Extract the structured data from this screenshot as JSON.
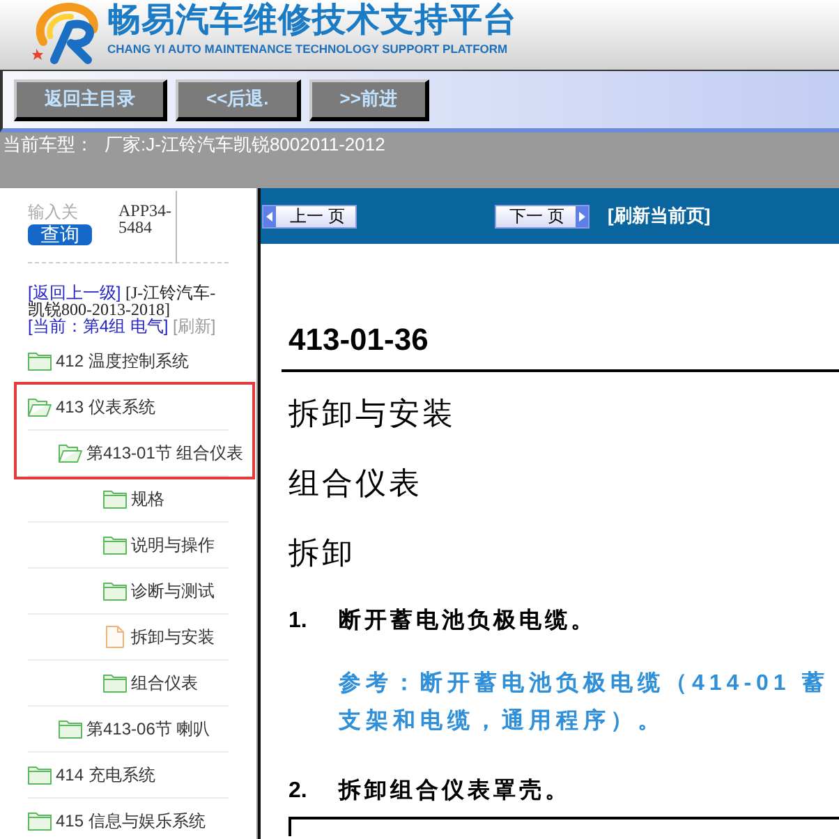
{
  "header": {
    "title": "畅易汽车维修技术支持平台",
    "subtitle": "CHANG YI AUTO MAINTENANCE TECHNOLOGY SUPPORT PLATFORM"
  },
  "nav_buttons": [
    "返回主目录",
    "<<后退.",
    ">>前进"
  ],
  "current_model": {
    "label": "当前车型：",
    "value": "厂家:J-江铃汽车凯锐8002011-2012"
  },
  "sidebar": {
    "search": {
      "placeholder": "输入关",
      "button": "查询"
    },
    "app_code": "APP34-5484",
    "breadcrumb": [
      {
        "kind": "link",
        "text": "[返回上一级]"
      },
      {
        "kind": "plain",
        "text": "[J-江铃汽车-凯锐800-2013-2018]"
      },
      {
        "kind": "link",
        "text": "[当前：第4组 电气]"
      },
      {
        "kind": "muted",
        "text": "[刷新]"
      }
    ],
    "tree": [
      {
        "label": "412 温度控制系统",
        "kind": "folder",
        "expanded": false,
        "highlighted": false
      },
      {
        "label": "413 仪表系统",
        "kind": "folder",
        "expanded": true,
        "highlighted": true,
        "children": [
          {
            "label": "第413-01节 组合仪表",
            "kind": "folder",
            "expanded": true,
            "highlighted": true,
            "children": [
              {
                "label": "规格",
                "kind": "folder",
                "expanded": false,
                "highlighted": false
              },
              {
                "label": "说明与操作",
                "kind": "folder",
                "expanded": false,
                "highlighted": false
              },
              {
                "label": "诊断与测试",
                "kind": "folder",
                "expanded": false,
                "highlighted": false
              },
              {
                "label": "拆卸与安装",
                "kind": "page",
                "highlighted": false
              },
              {
                "label": "组合仪表",
                "kind": "folder",
                "expanded": false,
                "highlighted": false
              }
            ]
          },
          {
            "label": "第413-06节 喇叭",
            "kind": "folder",
            "expanded": false,
            "highlighted": false
          }
        ]
      },
      {
        "label": "414 充电系统",
        "kind": "folder",
        "expanded": false,
        "highlighted": false
      },
      {
        "label": "415 信息与娱乐系统",
        "kind": "folder",
        "expanded": false,
        "highlighted": false
      }
    ]
  },
  "pager": {
    "previous": "上一 页",
    "next": "下一 页",
    "refresh": "[刷新当前页]"
  },
  "document": {
    "code": "413-01-36",
    "headings": [
      "拆卸与安装",
      "组合仪表",
      "拆卸"
    ],
    "steps": [
      {
        "number": "1.",
        "text": "断开蓄电池负极电缆。",
        "reference": [
          "参考：断开蓄电池负极电缆（414-01 蓄",
          "支架和电缆，通用程序）。"
        ]
      },
      {
        "number": "2.",
        "text": "拆卸组合仪表罩壳。"
      }
    ]
  }
}
